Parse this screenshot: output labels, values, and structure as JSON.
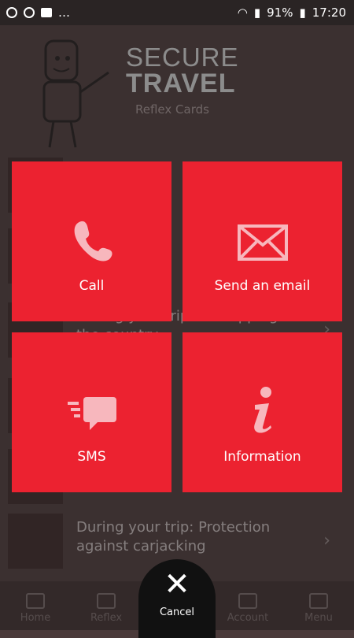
{
  "status_bar": {
    "battery": "91%",
    "time": "17:20"
  },
  "brand": {
    "line1": "SECURE",
    "line2": "TRAVEL",
    "subtitle": "Reflex Cards"
  },
  "list_items": [
    {
      "text": ""
    },
    {
      "text": ""
    },
    {
      "text": "During your trip: Kidnapping at the country"
    },
    {
      "text": ""
    },
    {
      "text": ""
    },
    {
      "text": "During your trip: Protection against carjacking"
    }
  ],
  "bottom_nav": [
    {
      "label": "Home"
    },
    {
      "label": "Reflex"
    },
    {
      "label": ""
    },
    {
      "label": "Account"
    },
    {
      "label": "Menu"
    }
  ],
  "tiles": {
    "call": "Call",
    "email": "Send an email",
    "sms": "SMS",
    "info": "Information"
  },
  "cancel_label": "Cancel",
  "colors": {
    "accent": "#ec2230",
    "icon": "#f7b7bd"
  }
}
